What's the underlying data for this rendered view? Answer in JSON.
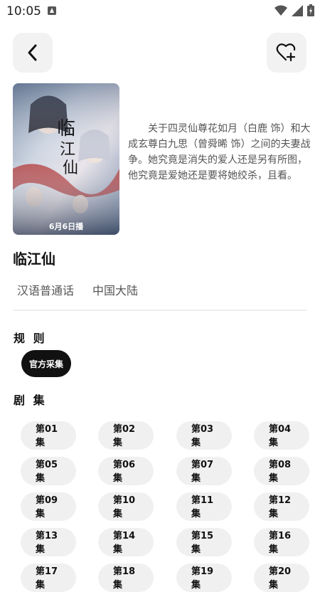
{
  "status_bar": {
    "time": "10:05"
  },
  "header": {
    "back_icon": "chevron-left-icon",
    "favorite_icon": "heart-plus-icon"
  },
  "poster": {
    "date_text": "6月6日播",
    "image_desc_icon": "drama-poster"
  },
  "synopsis": "关于四灵仙尊花如月（白鹿 饰）和大成玄尊白九思（曾舜晞 饰）之间的夫妻战争。她究竟是消失的爱人还是另有所图，他究竟是爱她还是要将她绞杀，且看。",
  "title": "临江仙",
  "tags": [
    "汉语普通话",
    "中国大陆"
  ],
  "rules": {
    "title": "规 则",
    "chips": [
      "官方采集"
    ]
  },
  "episodes": {
    "title": "剧 集",
    "items": [
      "第01集",
      "第02集",
      "第03集",
      "第04集",
      "第05集",
      "第06集",
      "第07集",
      "第08集",
      "第09集",
      "第10集",
      "第11集",
      "第12集",
      "第13集",
      "第14集",
      "第15集",
      "第16集",
      "第17集",
      "第18集",
      "第19集",
      "第20集"
    ]
  }
}
